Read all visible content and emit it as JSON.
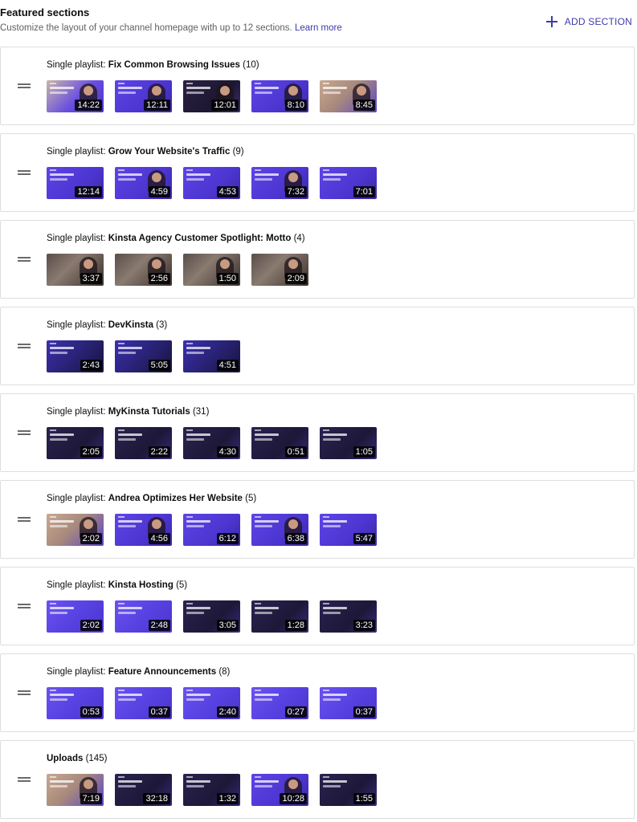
{
  "header": {
    "title": "Featured sections",
    "subtitle": "Customize the layout of your channel homepage with up to 12 sections.",
    "learn_more": "Learn more",
    "add_section": "ADD SECTION"
  },
  "colors": {
    "accent": "#3e3ba8",
    "thumb_purple": "#5b40e0",
    "thumb_dark": "#2a2250"
  },
  "sections": [
    {
      "prefix": "Single playlist: ",
      "name": "Fix Common Browsing Issues",
      "count": "(10)",
      "videos": [
        {
          "duration": "14:22",
          "style": "p1"
        },
        {
          "duration": "12:11",
          "style": "p2"
        },
        {
          "duration": "12:01",
          "style": "p3"
        },
        {
          "duration": "8:10",
          "style": "p2"
        },
        {
          "duration": "8:45",
          "style": "p4"
        }
      ]
    },
    {
      "prefix": "Single playlist: ",
      "name": "Grow Your Website's Traffic",
      "count": "(9)",
      "videos": [
        {
          "duration": "12:14",
          "style": "p2"
        },
        {
          "duration": "4:59",
          "style": "p2"
        },
        {
          "duration": "4:53",
          "style": "p2"
        },
        {
          "duration": "7:32",
          "style": "p2"
        },
        {
          "duration": "7:01",
          "style": "p2"
        }
      ]
    },
    {
      "prefix": "Single playlist: ",
      "name": "Kinsta Agency Customer Spotlight: Motto",
      "count": "(4)",
      "videos": [
        {
          "duration": "3:37",
          "style": "photo"
        },
        {
          "duration": "2:56",
          "style": "photo"
        },
        {
          "duration": "1:50",
          "style": "photo"
        },
        {
          "duration": "2:09",
          "style": "photo"
        }
      ]
    },
    {
      "prefix": "Single playlist: ",
      "name": "DevKinsta",
      "count": "(3)",
      "videos": [
        {
          "duration": "2:43",
          "style": "dev"
        },
        {
          "duration": "5:05",
          "style": "dev"
        },
        {
          "duration": "4:51",
          "style": "dev"
        }
      ]
    },
    {
      "prefix": "Single playlist: ",
      "name": "MyKinsta Tutorials",
      "count": "(31)",
      "videos": [
        {
          "duration": "2:05",
          "style": "dark"
        },
        {
          "duration": "2:22",
          "style": "dark"
        },
        {
          "duration": "4:30",
          "style": "dark"
        },
        {
          "duration": "0:51",
          "style": "dark"
        },
        {
          "duration": "1:05",
          "style": "dark"
        }
      ]
    },
    {
      "prefix": "Single playlist: ",
      "name": "Andrea Optimizes Her Website",
      "count": "(5)",
      "videos": [
        {
          "duration": "2:02",
          "style": "p4"
        },
        {
          "duration": "4:56",
          "style": "p2"
        },
        {
          "duration": "6:12",
          "style": "p2"
        },
        {
          "duration": "6:38",
          "style": "p2"
        },
        {
          "duration": "5:47",
          "style": "p2"
        }
      ]
    },
    {
      "prefix": "Single playlist: ",
      "name": "Kinsta Hosting",
      "count": "(5)",
      "videos": [
        {
          "duration": "2:02",
          "style": "bright"
        },
        {
          "duration": "2:48",
          "style": "bright"
        },
        {
          "duration": "3:05",
          "style": "dark"
        },
        {
          "duration": "1:28",
          "style": "dark"
        },
        {
          "duration": "3:23",
          "style": "dark"
        }
      ]
    },
    {
      "prefix": "Single playlist: ",
      "name": "Feature Announcements",
      "count": "(8)",
      "videos": [
        {
          "duration": "0:53",
          "style": "bright"
        },
        {
          "duration": "0:37",
          "style": "bright"
        },
        {
          "duration": "2:40",
          "style": "bright"
        },
        {
          "duration": "0:27",
          "style": "bright"
        },
        {
          "duration": "0:37",
          "style": "bright"
        }
      ]
    },
    {
      "prefix": "",
      "name": "Uploads",
      "count": "(145)",
      "videos": [
        {
          "duration": "7:19",
          "style": "p4"
        },
        {
          "duration": "32:18",
          "style": "dark"
        },
        {
          "duration": "1:32",
          "style": "dark"
        },
        {
          "duration": "10:28",
          "style": "p2"
        },
        {
          "duration": "1:55",
          "style": "dark"
        }
      ]
    }
  ]
}
